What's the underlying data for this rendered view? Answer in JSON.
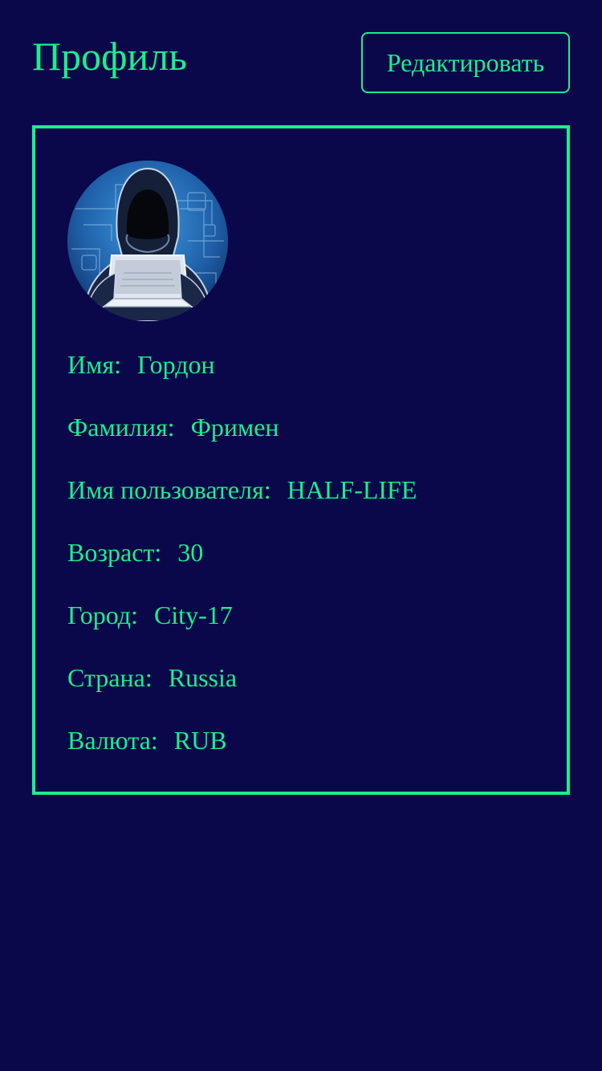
{
  "header": {
    "title": "Профиль",
    "edit_label": "Редактировать"
  },
  "avatar": {
    "icon": "hacker-avatar-icon"
  },
  "profile": {
    "fields": [
      {
        "label": "Имя:",
        "value": "Гордон"
      },
      {
        "label": "Фамилия:",
        "value": "Фримен"
      },
      {
        "label": "Имя пользователя:",
        "value": "HALF-LIFE"
      },
      {
        "label": "Возраст:",
        "value": "30"
      },
      {
        "label": "Город:",
        "value": "City-17"
      },
      {
        "label": "Страна:",
        "value": "Russia"
      },
      {
        "label": "Валюта:",
        "value": "RUB"
      }
    ]
  },
  "colors": {
    "background": "#0a074a",
    "accent": "#19f08a"
  }
}
